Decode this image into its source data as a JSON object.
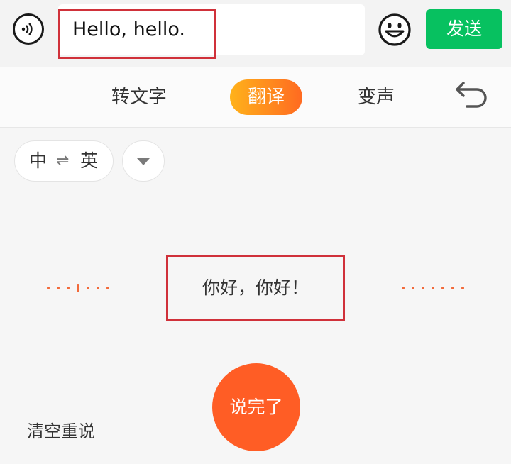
{
  "input": {
    "value": "Hello, hello.",
    "send_label": "发送"
  },
  "modes": {
    "to_text": "转文字",
    "translate": "翻译",
    "voice_change": "变声"
  },
  "language": {
    "source": "中",
    "swap_symbol": "⇌",
    "target": "英"
  },
  "translation": {
    "result": "你好，你好！"
  },
  "actions": {
    "finish_label": "说完了",
    "clear_label": "清空重说"
  },
  "colors": {
    "send_green": "#07c160",
    "accent_orange": "#ff5d25",
    "highlight_red": "#d0313a"
  }
}
